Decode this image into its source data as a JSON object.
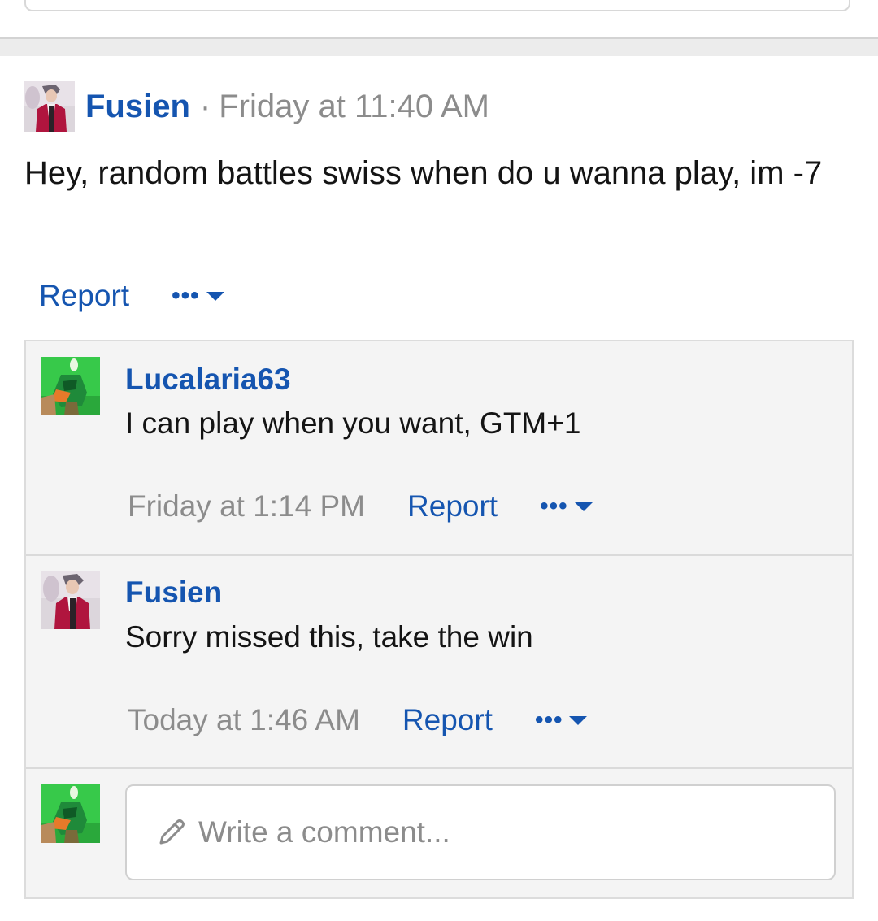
{
  "post": {
    "author": "Fusien",
    "separator": "·",
    "timestamp": "Friday at 11:40 AM",
    "body": "Hey, random battles swiss when do u wanna play, im -7",
    "report_label": "Report",
    "more_label": "•••"
  },
  "comments": [
    {
      "author": "Lucalaria63",
      "text": "I can play when you want, GTM+1",
      "timestamp": "Friday at 1:14 PM",
      "report_label": "Report",
      "more_label": "•••"
    },
    {
      "author": "Fusien",
      "text": "Sorry missed this, take the win",
      "timestamp": "Today at 1:46 AM",
      "report_label": "Report",
      "more_label": "•••"
    }
  ],
  "comment_box": {
    "placeholder": "Write a comment..."
  },
  "colors": {
    "link": "#1555b0",
    "meta_text": "#8c8c8c",
    "comment_bg": "#f4f4f4",
    "border": "#dcdcdc"
  },
  "icons": {
    "fusien_avatar": "avatar-fusien-icon",
    "lucalaria_avatar": "avatar-lucalaria-icon",
    "more": "ellipsis-icon",
    "caret": "caret-down-icon",
    "pencil": "pencil-icon"
  }
}
